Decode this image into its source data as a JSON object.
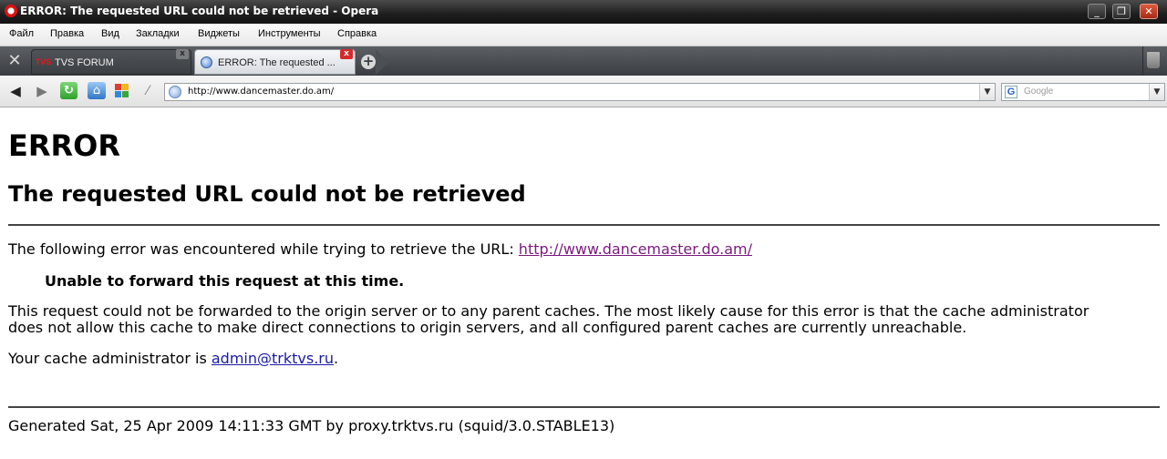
{
  "window": {
    "title": "ERROR: The requested URL could not be retrieved - Opera"
  },
  "menu": [
    "Файл",
    "Правка",
    "Вид",
    "Закладки",
    "Виджеты",
    "Инструменты",
    "Справка"
  ],
  "tabs": [
    {
      "favicon_text": "TVS",
      "label": "TVS FORUM",
      "active": false
    },
    {
      "label": "ERROR: The requested ...",
      "active": true
    }
  ],
  "address_bar": {
    "url": "http://www.dancemaster.do.am/"
  },
  "search_box": {
    "placeholder": "Google"
  },
  "page": {
    "h1": "ERROR",
    "h2": "The requested URL could not be retrieved",
    "error_intro": "The following error was encountered while trying to retrieve the URL: ",
    "error_url": "http://www.dancemaster.do.am/",
    "error_message": "Unable to forward this request at this time.",
    "explanation_line1": "This request could not be forwarded to the origin server or to any parent caches. The most likely cause for this error is that the cache administrator",
    "explanation_line2": "does not allow this cache to make direct connections to origin servers, and all configured parent caches are currently unreachable.",
    "admin_prefix": "Your cache administrator is ",
    "admin_email": "admin@trktvs.ru",
    "admin_suffix": ".",
    "footer": "Generated Sat, 25 Apr 2009 14:11:33 GMT by proxy.trktvs.ru (squid/3.0.STABLE13)"
  },
  "colors": {
    "visited_link": "#7a1b7e",
    "mail_link": "#1a1aa6"
  }
}
